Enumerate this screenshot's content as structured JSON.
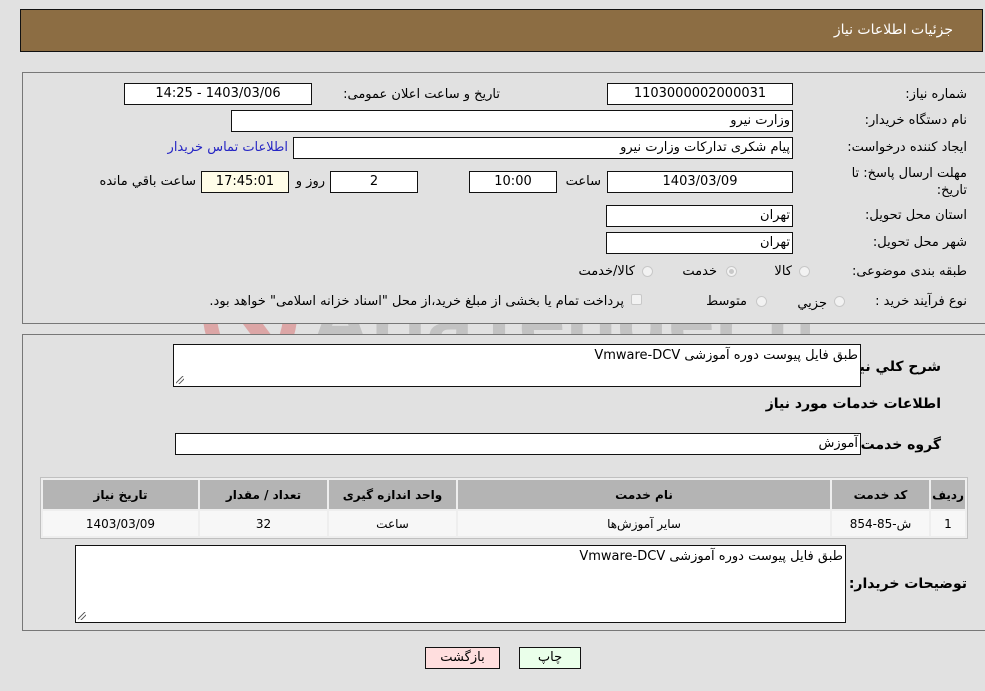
{
  "header": {
    "title": "جزئیات اطلاعات نیاز"
  },
  "details": {
    "need_number": {
      "label": "شماره نیاز:",
      "value": "1103000002000031"
    },
    "announce_datetime": {
      "label": "تاریخ و ساعت اعلان عمومی:",
      "value": "1403/03/06 - 14:25"
    },
    "buyer_org": {
      "label": "نام دستگاه خریدار:",
      "value": "وزارت نیرو"
    },
    "requester": {
      "label": "ایجاد کننده درخواست:",
      "value": "پیام شکری تدارکات وزارت نیرو"
    },
    "buyer_contact_link": "اطلاعات تماس خریدار",
    "deadline": {
      "label": "مهلت ارسال پاسخ: تا تاریخ:",
      "date": "1403/03/09",
      "time_label": "ساعت",
      "time": "10:00",
      "days": "2",
      "days_label": "روز و",
      "remaining": "17:45:01",
      "remaining_label": "ساعت باقي مانده"
    },
    "province": {
      "label": "استان محل تحویل:",
      "value": "تهران"
    },
    "city": {
      "label": "شهر محل تحویل:",
      "value": "تهران"
    },
    "category": {
      "label": "طبقه بندی موضوعی:",
      "options": [
        "کالا",
        "خدمت",
        "کالا/خدمت"
      ],
      "selected": "خدمت"
    },
    "process_type": {
      "label": "نوع فرآیند خرید :",
      "options": [
        "جزیي",
        "متوسط"
      ],
      "treasury_note": "پرداخت تمام یا بخشی از مبلغ خرید،از محل \"اسناد خزانه اسلامی\" خواهد بود."
    }
  },
  "services": {
    "summary_label": "شرح كلي نياز:",
    "summary_value": "طبق فایل پیوست دوره آموزشی  Vmware-DCV",
    "section_title": "اطلاعات خدمات مورد نیاز",
    "group_label": "گروه خدمت:",
    "group_value": "آموزش",
    "table": {
      "headers": [
        "ردیف",
        "کد خدمت",
        "نام خدمت",
        "واحد اندازه گیری",
        "تعداد / مقدار",
        "تاریخ نیاز"
      ],
      "rows": [
        [
          "1",
          "ش-85-854",
          "سایر آموزش‌ها",
          "ساعت",
          "32",
          "1403/03/09"
        ]
      ]
    },
    "buyer_notes_label": "توضیحات خریدار:",
    "buyer_notes_value": "طبق فایل پیوست دوره آموزشی  Vmware-DCV"
  },
  "buttons": {
    "print": "چاپ",
    "back": "بازگشت"
  },
  "watermark": "AriaTender.neT",
  "colors": {
    "header_bg": "#8c6d43",
    "print_bg": "#eaffea",
    "back_bg": "#ffdede",
    "link": "#2626c4"
  }
}
